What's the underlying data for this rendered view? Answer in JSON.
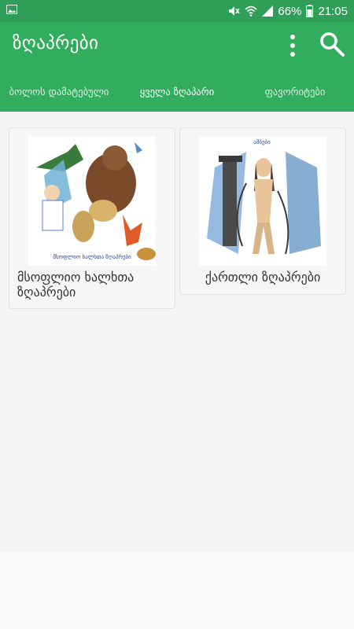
{
  "status_bar": {
    "battery": "66%",
    "time": "21:05",
    "icons": [
      "image-icon",
      "mute-icon",
      "wifi-icon",
      "signal-icon",
      "battery-icon"
    ]
  },
  "app_bar": {
    "title": "ზღაპრები",
    "icons": [
      "more-vert-icon",
      "search-icon"
    ]
  },
  "tabs": [
    {
      "label": "ბოლოს დამატებული",
      "active": false
    },
    {
      "label": "ყველა ზღაპარი",
      "active": true
    },
    {
      "label": "ფავორიტები",
      "active": false
    }
  ],
  "books": [
    {
      "title": "მსოფლიო ხალხთა ზღაპრები",
      "cover_caption": "მსოფლიო ხალხთა ზღაპრები"
    },
    {
      "title": "ქართლი ზღაპრები",
      "cover_caption": "ამბები"
    }
  ],
  "colors": {
    "primary": "#32ad5e",
    "status": "#2f9e57",
    "background": "#f5f5f5"
  }
}
